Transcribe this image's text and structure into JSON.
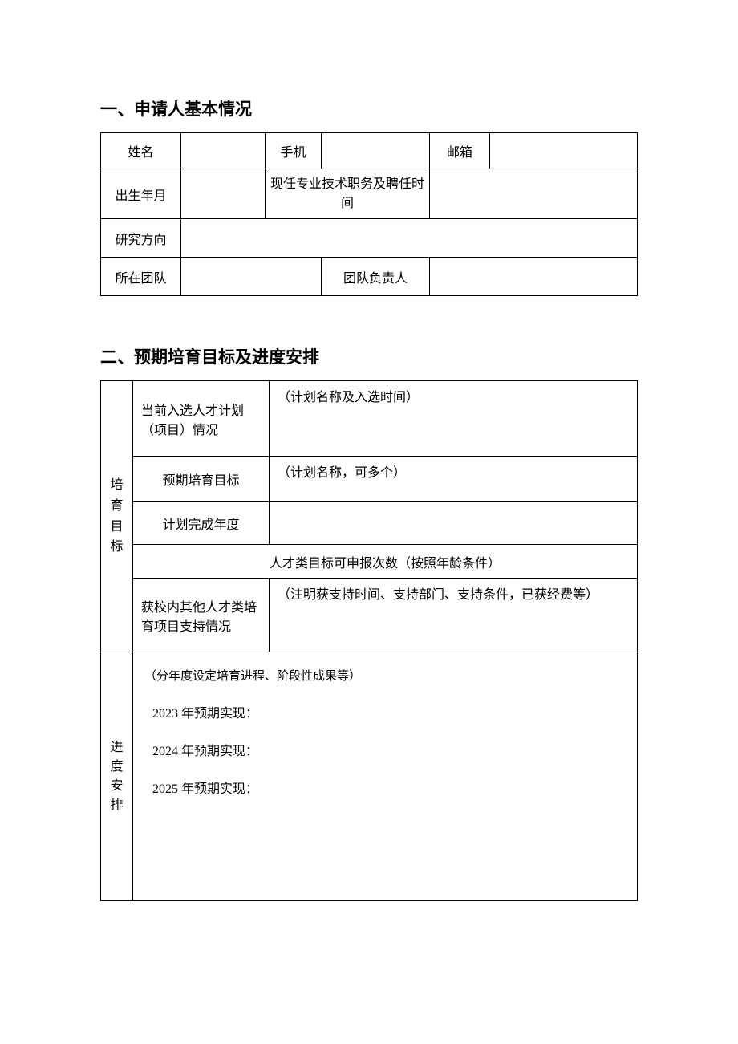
{
  "section1": {
    "heading": "一、申请人基本情况",
    "row1": {
      "name_label": "姓名",
      "name_value": "",
      "phone_label": "手机",
      "phone_value": "",
      "email_label": "邮箱",
      "email_value": ""
    },
    "row2": {
      "birth_label": "出生年月",
      "birth_value": "",
      "position_label": "现任专业技术职务及聘任时间",
      "position_value": ""
    },
    "row3": {
      "research_label": "研究方向",
      "research_value": ""
    },
    "row4": {
      "team_label": "所在团队",
      "team_value": "",
      "leader_label": "团队负责人",
      "leader_value": ""
    }
  },
  "section2": {
    "heading": "二、预期培育目标及进度安排",
    "vheader_goal": "培育目标",
    "vheader_plan": "进度安排",
    "rows": {
      "current": {
        "label": "当前入选人才计划（项目）情况",
        "hint": "（计划名称及入选时间）",
        "value": ""
      },
      "goal": {
        "label": "预期培育目标",
        "hint": "（计划名称，可多个）",
        "value": ""
      },
      "completion_year": {
        "label": "计划完成年度",
        "value": ""
      },
      "apply_times": {
        "label": "人才类目标可申报次数（按照年龄条件）"
      },
      "other_support": {
        "label": "获校内其他人才类培育项目支持情况",
        "hint": "（注明获支持时间、支持部门、支持条件，已获经费等）",
        "value": ""
      },
      "plan": {
        "note": "（分年度设定培育进程、阶段性成果等）",
        "y2023": "2023 年预期实现：",
        "y2024": "2024 年预期实现：",
        "y2025": "2025 年预期实现："
      }
    }
  }
}
